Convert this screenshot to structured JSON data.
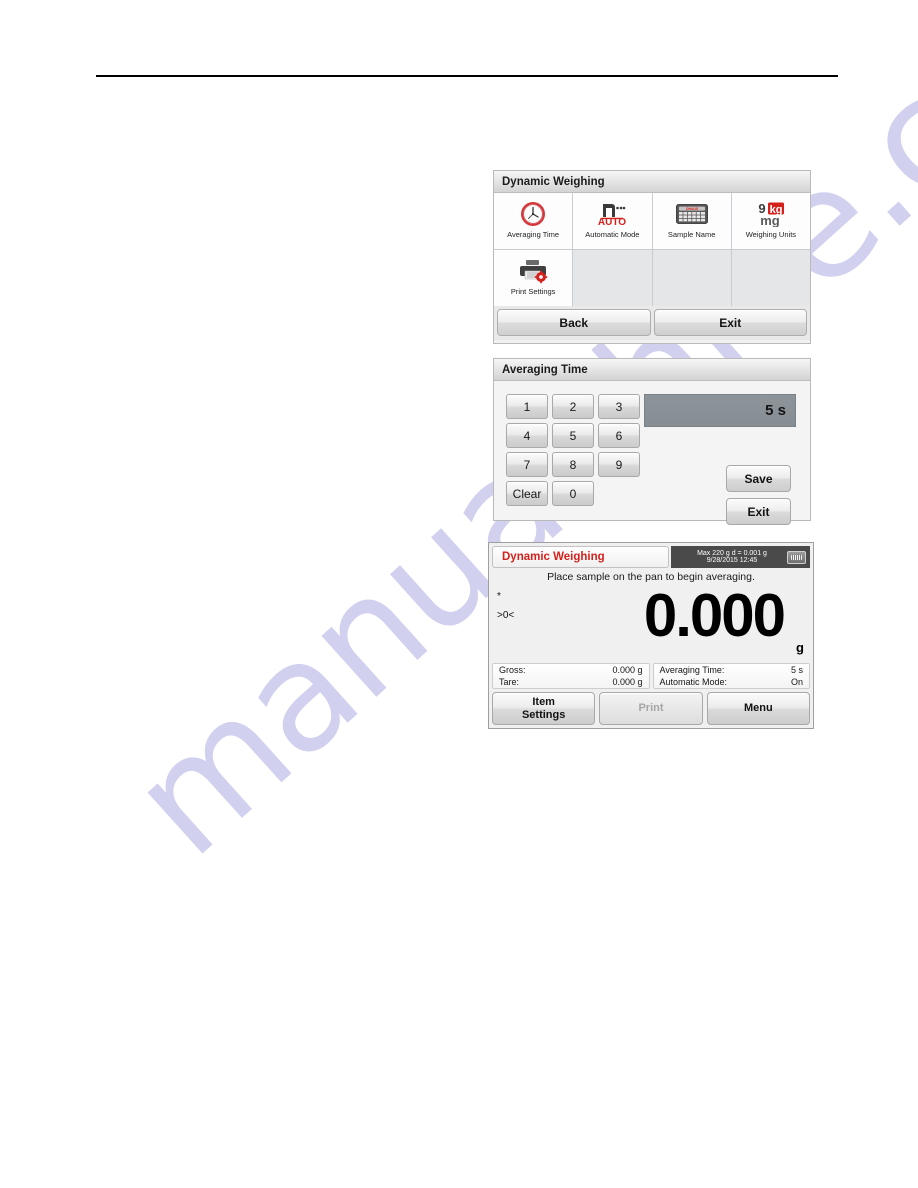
{
  "watermark": {
    "text": "manualshive.com",
    "color": "#c9c8ec"
  },
  "menu_panel": {
    "title": "Dynamic Weighing",
    "items": [
      {
        "label": "Averaging Time",
        "icon": "clock-icon"
      },
      {
        "label": "Automatic Mode",
        "icon": "auto-mode-icon"
      },
      {
        "label": "Sample Name",
        "icon": "keyboard-icon"
      },
      {
        "label": "Weighing Units",
        "icon": "weighing-units-icon"
      },
      {
        "label": "Print Settings",
        "icon": "printer-gear-icon"
      }
    ],
    "back_label": "Back",
    "exit_label": "Exit"
  },
  "keypad_panel": {
    "title": "Averaging Time",
    "keys": [
      "1",
      "2",
      "3",
      "4",
      "5",
      "6",
      "7",
      "8",
      "9",
      "Clear",
      "0"
    ],
    "value": "5 s",
    "save_label": "Save",
    "exit_label": "Exit"
  },
  "display_panel": {
    "mode": "Dynamic Weighing",
    "mode_color": "#d5211c",
    "spec_line1": "Max 220 g   d = 0.001 g",
    "spec_line2": "9/28/2015   12:45",
    "port_icon": "serial-port-icon",
    "instruction": "Place sample on the pan to begin averaging.",
    "flag_stable": "*",
    "flag_zero": ">0<",
    "reading": "0.000",
    "unit": "g",
    "info_left": [
      {
        "label": "Gross:",
        "value": "0.000 g"
      },
      {
        "label": "Tare:",
        "value": "0.000 g"
      }
    ],
    "info_right": [
      {
        "label": "Averaging Time:",
        "value": "5 s"
      },
      {
        "label": "Automatic Mode:",
        "value": "On"
      }
    ],
    "buttons": {
      "item_line1": "Item",
      "item_line2": "Settings",
      "print": "Print",
      "menu": "Menu"
    }
  }
}
